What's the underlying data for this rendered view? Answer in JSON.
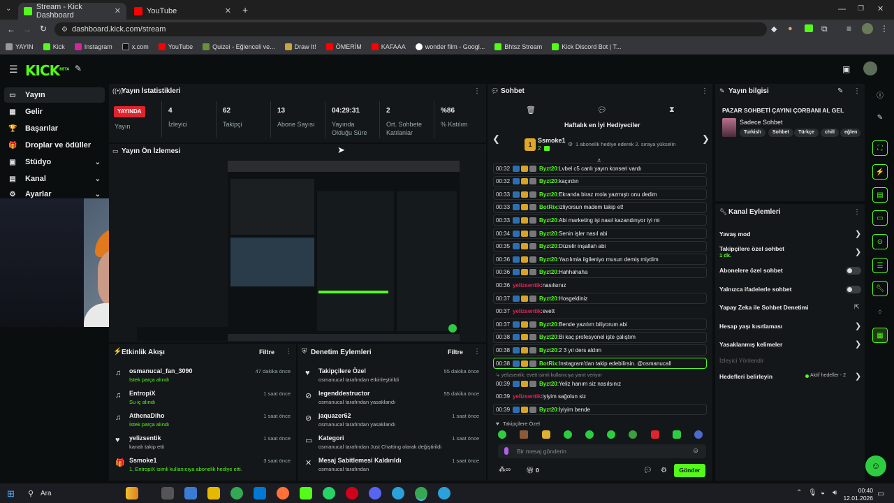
{
  "browser": {
    "tabs": [
      {
        "label": "Stream - Kick Dashboard",
        "active": true
      },
      {
        "label": "YouTube",
        "active": false
      }
    ],
    "new_tab": "+",
    "url": "dashboard.kick.com/stream",
    "bookmarks": [
      "YAYIN",
      "Kick",
      "Instagram",
      "x.com",
      "YouTube",
      "Quizei - Eğlenceli ve...",
      "Draw It!",
      "ÖMERİM",
      "KAFAAA",
      "wonder film - Googl...",
      "Bhtsz Stream",
      "Kick Discord Bot | T..."
    ]
  },
  "kick": {
    "logo": "KICK",
    "logo_sup": "BETA"
  },
  "sidebar": {
    "items": [
      {
        "label": "Yayın",
        "icon": "▭"
      },
      {
        "label": "Gelir",
        "icon": "▦"
      },
      {
        "label": "Başarılar",
        "icon": "🏆"
      },
      {
        "label": "Droplar ve ödüller",
        "icon": "🎁"
      },
      {
        "label": "Stüdyo",
        "icon": "▣"
      },
      {
        "label": "Kanal",
        "icon": "▤"
      },
      {
        "label": "Ayarlar",
        "icon": "⚙"
      }
    ]
  },
  "stats": {
    "title": "Yayın İstatistikleri",
    "live_badge": "YAYINDA",
    "live_label": "Yayın",
    "items": [
      {
        "value": "4",
        "label": "İzleyici"
      },
      {
        "value": "62",
        "label": "Takipçi"
      },
      {
        "value": "13",
        "label": "Abone Sayısı"
      },
      {
        "value": "04:29:31",
        "label": "Yayında Olduğu Süre"
      },
      {
        "value": "2",
        "label": "Ort. Sohbete Katılanlar"
      },
      {
        "value": "%86",
        "label": "% Katılım"
      }
    ]
  },
  "preview": {
    "title": "Yayın Ön İzlemesi"
  },
  "activity": {
    "title": "Etkinlik Akışı",
    "filter": "Filtre",
    "items": [
      {
        "name": "osmanucal_fan_3090",
        "sub": "İstek parça alındı",
        "time": "47 dakika önce",
        "icon": "♫"
      },
      {
        "name": "EntropiX",
        "sub": "Su iç alındı",
        "time": "1 saat önce",
        "icon": "♫"
      },
      {
        "name": "AthenaDiho",
        "sub": "İstek parça alındı",
        "time": "1 saat önce",
        "icon": "♫"
      },
      {
        "name": "yelizsentik",
        "sub": "kanalı takip etti",
        "time": "1 saat önce",
        "icon": "♥"
      },
      {
        "name": "Ssmoke1",
        "sub": "1, EntropiX isimli kullanıcıya abonelik hediye etti.",
        "time": "3 saat önce",
        "icon": "🎁"
      }
    ]
  },
  "moderation": {
    "title": "Denetim Eylemleri",
    "filter": "Filtre",
    "items": [
      {
        "name": "Takipçilere Özel",
        "sub": "osmanucal tarafından etkinleştirildi",
        "time": "55 dakika önce",
        "icon": "♥"
      },
      {
        "name": "legenddestructor",
        "sub": "osmanucal tarafından yasaklandı",
        "time": "55 dakika önce",
        "icon": "⊘"
      },
      {
        "name": "jaquazer62",
        "sub": "osmanucal tarafından yasaklandı",
        "time": "1 saat önce",
        "icon": "⊘"
      },
      {
        "name": "Kategori",
        "sub": "osmanucal tarafından Just Chatting olarak değiştirildi",
        "time": "1 saat önce",
        "icon": "▭"
      },
      {
        "name": "Mesaj Sabitlemesi Kaldırıldı",
        "sub": "osmanucal tarafından",
        "time": "1 saat önce",
        "icon": "✕"
      }
    ]
  },
  "chat": {
    "title": "Sohbet",
    "gifters_title": "Haftalık en İyi Hediyeciler",
    "top_gifter": "Ssmoke1",
    "top_gifter_count": "2",
    "gifter_rank": "1",
    "gifter_hint": "1 abonelik hediye ederek 2. sıraya yükselin",
    "messages": [
      {
        "time": "00:32",
        "user": "Byzt20",
        "text": "Lvbel c5 canlı yayın konseri vardı",
        "style": "box",
        "color": "#53fc18",
        "badges": 3
      },
      {
        "time": "00:32",
        "user": "Byzt20",
        "text": "kaçırdın",
        "style": "box",
        "color": "#53fc18",
        "badges": 3
      },
      {
        "time": "00:33",
        "user": "Byzt20",
        "text": "Ekranda biraz mola yazmıştı onu dedim",
        "style": "box",
        "color": "#53fc18",
        "badges": 3
      },
      {
        "time": "00:33",
        "user": "BotRix",
        "text": "izliyorsun madem takip et!",
        "style": "box",
        "color": "#53fc18",
        "badges": 3
      },
      {
        "time": "00:33",
        "user": "Byzt20",
        "text": "Abi marketing işi nasıl kazandırıyor iyi mi",
        "style": "box",
        "color": "#53fc18",
        "badges": 3
      },
      {
        "time": "00:34",
        "user": "Byzt20",
        "text": "Senin işler nasıl abi",
        "style": "box",
        "color": "#53fc18",
        "badges": 3
      },
      {
        "time": "00:35",
        "user": "Byzt20",
        "text": "Düzelir inşallah abi",
        "style": "box",
        "color": "#53fc18",
        "badges": 3
      },
      {
        "time": "00:36",
        "user": "Byzt20",
        "text": "Yazılımla ilgileniyo musun demiş miydim",
        "style": "box",
        "color": "#53fc18",
        "badges": 3
      },
      {
        "time": "00:36",
        "user": "Byzt20",
        "text": "Hahhahaha",
        "style": "box",
        "color": "#53fc18",
        "badges": 3
      },
      {
        "time": "00:36",
        "user": "yelizsentik",
        "text": "nasılsınız",
        "style": "plain",
        "color": "#e0245e",
        "badges": 0
      },
      {
        "time": "00:37",
        "user": "Byzt20",
        "text": "Hosgeldiniz",
        "style": "box",
        "color": "#53fc18",
        "badges": 3
      },
      {
        "time": "00:37",
        "user": "yelizsentik",
        "text": "evett",
        "style": "plain",
        "color": "#e0245e",
        "badges": 0
      },
      {
        "time": "00:37",
        "user": "Byzt20",
        "text": "Bende yazılım biliyorum abi",
        "style": "box",
        "color": "#53fc18",
        "badges": 3
      },
      {
        "time": "00:38",
        "user": "Byzt20",
        "text": "Bi kaç profesyonel işte çalıştım",
        "style": "box",
        "color": "#53fc18",
        "badges": 3
      },
      {
        "time": "00:38",
        "user": "Byzt20",
        "text": "2 3 yıl ders aldım",
        "style": "box",
        "color": "#53fc18",
        "badges": 3
      },
      {
        "time": "00:38",
        "user": "BotRix",
        "text": "Instagram'dan takip edebilirsin. @osmanucall",
        "style": "hl",
        "color": "#53fc18",
        "badges": 3
      }
    ],
    "reply_note": "yelizsentik: evett isimli kullanıcıya yanıt veriyor",
    "messages2": [
      {
        "time": "00:39",
        "user": "Byzt20",
        "text": "Yeliz hanım siz nasılsınız",
        "style": "plain",
        "color": "#53fc18",
        "badges": 3
      },
      {
        "time": "00:39",
        "user": "yelizsentik",
        "text": "iyiyim sağolun siz",
        "style": "plain",
        "color": "#e0245e",
        "badges": 0
      },
      {
        "time": "00:39",
        "user": "Byzt20",
        "text": "İyiyim bende",
        "style": "box",
        "color": "#53fc18",
        "badges": 3
      }
    ],
    "followers_only": "Takipçilere Özel",
    "input_placeholder": "Bir mesaj gönderin",
    "viewers_count": "0",
    "send_label": "Gönder"
  },
  "info": {
    "title": "Yayın bilgisi",
    "stream_title": "PAZAR SOHBETİ ÇAYINI ÇORBANI AL GEL",
    "category": "Sadece Sohbet",
    "tags": [
      "Turkish",
      "Sohbet",
      "Türkçe",
      "chill",
      "eğlen"
    ]
  },
  "channel_actions": {
    "title": "Kanal Eylemleri",
    "items": [
      {
        "label": "Yavaş mod",
        "kind": "chevron"
      },
      {
        "label": "Takipçilere özel sohbet",
        "sub": "1 dk.",
        "kind": "chevron"
      },
      {
        "label": "Abonelere özel sohbet",
        "kind": "toggle"
      },
      {
        "label": "Yalnızca ifadelerle sohbet",
        "kind": "toggle"
      },
      {
        "label": "Yapay Zeka ile Sohbet Denetimi",
        "kind": "external"
      },
      {
        "label": "Hesap yaşı kısıtlaması",
        "kind": "chevron"
      },
      {
        "label": "Yasaklanmış kelimeler",
        "kind": "chevron"
      },
      {
        "label": "İzleyici Yönlendir",
        "kind": "disabled"
      },
      {
        "label": "Hedefleri belirleyin",
        "kind": "chevron",
        "extra": "Aktif hedefler - 2"
      }
    ]
  },
  "taskbar": {
    "search": "Ara",
    "time": "00:40",
    "date": "12.01.2026"
  }
}
